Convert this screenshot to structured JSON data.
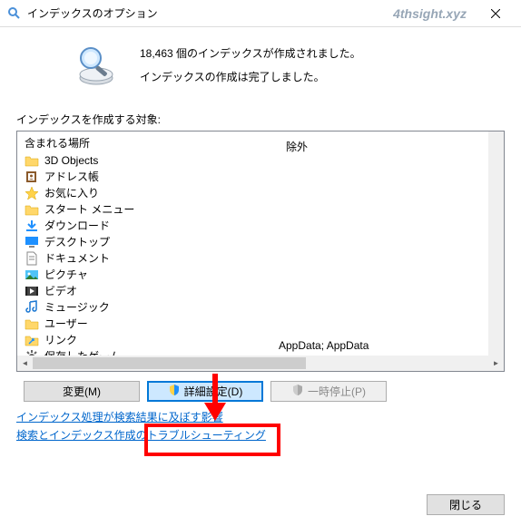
{
  "titlebar": {
    "title": "インデックスのオプション",
    "watermark": "4thsight.xyz"
  },
  "summary": {
    "count_line": "18,463 個のインデックスが作成されました。",
    "status_line": "インデックスの作成は完了しました。"
  },
  "target_label": "インデックスを作成する対象:",
  "columns": {
    "included": "含まれる場所",
    "excluded": "除外"
  },
  "items": [
    {
      "icon": "folder",
      "label": "3D Objects"
    },
    {
      "icon": "addressbook",
      "label": "アドレス帳"
    },
    {
      "icon": "star",
      "label": "お気に入り"
    },
    {
      "icon": "folder",
      "label": "スタート メニュー"
    },
    {
      "icon": "download",
      "label": "ダウンロード"
    },
    {
      "icon": "monitor",
      "label": "デスクトップ"
    },
    {
      "icon": "document",
      "label": "ドキュメント"
    },
    {
      "icon": "pictures",
      "label": "ピクチャ"
    },
    {
      "icon": "video",
      "label": "ビデオ"
    },
    {
      "icon": "music",
      "label": "ミュージック"
    },
    {
      "icon": "folder",
      "label": "ユーザー",
      "excluded": "AppData; AppData"
    },
    {
      "icon": "link",
      "label": "リンク"
    },
    {
      "icon": "gear",
      "label": "保存したゲーム"
    }
  ],
  "buttons": {
    "modify": "変更(M)",
    "advanced": "詳細設定(D)",
    "pause": "一時停止(P)"
  },
  "links": {
    "impact": "インデックス処理が検索結果に及ぼす影響",
    "troubleshoot": "検索とインデックス作成のトラブルシューティング"
  },
  "footer": {
    "close": "閉じる"
  }
}
